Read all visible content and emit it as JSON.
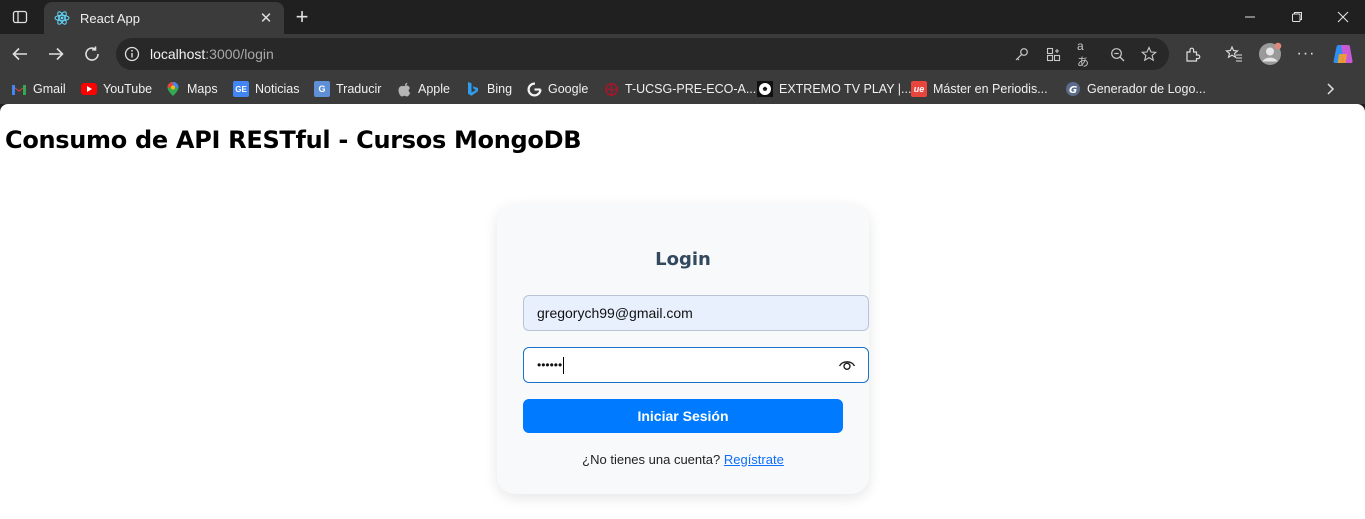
{
  "browser": {
    "tab_title": "React App",
    "url_host": "localhost",
    "url_path": ":3000/login",
    "bookmarks": [
      {
        "label": "Gmail",
        "icon": "gmail-icon"
      },
      {
        "label": "YouTube",
        "icon": "youtube-icon"
      },
      {
        "label": "Maps",
        "icon": "maps-icon"
      },
      {
        "label": "Noticias",
        "icon": "news-icon"
      },
      {
        "label": "Traducir",
        "icon": "translate-icon"
      },
      {
        "label": "Apple",
        "icon": "apple-icon"
      },
      {
        "label": "Bing",
        "icon": "bing-icon"
      },
      {
        "label": "Google",
        "icon": "google-icon"
      },
      {
        "label": "T-UCSG-PRE-ECO-A...",
        "icon": "ucsg-icon"
      },
      {
        "label": "EXTREMO TV PLAY |...",
        "icon": "soccer-icon"
      },
      {
        "label": "Máster en Periodis...",
        "icon": "ue-icon"
      },
      {
        "label": "Generador de Logo...",
        "icon": "logo-generator-icon"
      }
    ]
  },
  "page": {
    "title": "Consumo de API RESTful - Cursos MongoDB"
  },
  "login": {
    "title": "Login",
    "email_value": "gregorych99@gmail.com",
    "password_masked": "••••••",
    "submit_label": "Iniciar Sesión",
    "register_prompt": "¿No tienes una cuenta?",
    "register_link": "Regístrate"
  },
  "colors": {
    "primary_button": "#007bff",
    "link": "#0d6efd",
    "card_title": "#34495e",
    "email_autofill_bg": "#e8f0fe",
    "focus_border": "#1a73c8"
  }
}
